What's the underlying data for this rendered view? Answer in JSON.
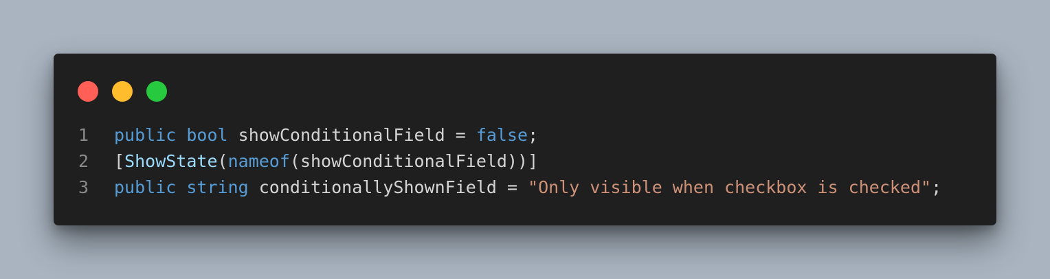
{
  "window": {
    "controls": [
      {
        "name": "close",
        "color": "#ff5f56"
      },
      {
        "name": "minimize",
        "color": "#ffbd2e"
      },
      {
        "name": "maximize",
        "color": "#27c93f"
      }
    ]
  },
  "code": {
    "lines": [
      {
        "number": "1",
        "tokens": [
          {
            "t": "public",
            "c": "kw"
          },
          {
            "t": " ",
            "c": "txt"
          },
          {
            "t": "bool",
            "c": "kw"
          },
          {
            "t": " showConditionalField = ",
            "c": "txt"
          },
          {
            "t": "false",
            "c": "kw"
          },
          {
            "t": ";",
            "c": "txt"
          }
        ]
      },
      {
        "number": "2",
        "tokens": [
          {
            "t": "[",
            "c": "txt"
          },
          {
            "t": "ShowState",
            "c": "type"
          },
          {
            "t": "(",
            "c": "txt"
          },
          {
            "t": "nameof",
            "c": "kw"
          },
          {
            "t": "(showConditionalField))]",
            "c": "txt"
          }
        ]
      },
      {
        "number": "3",
        "tokens": [
          {
            "t": "public",
            "c": "kw"
          },
          {
            "t": " ",
            "c": "txt"
          },
          {
            "t": "string",
            "c": "kw"
          },
          {
            "t": " conditionallyShownField = ",
            "c": "txt"
          },
          {
            "t": "\"Only visible when checkbox is checked\"",
            "c": "str"
          },
          {
            "t": ";",
            "c": "txt"
          }
        ]
      }
    ]
  }
}
